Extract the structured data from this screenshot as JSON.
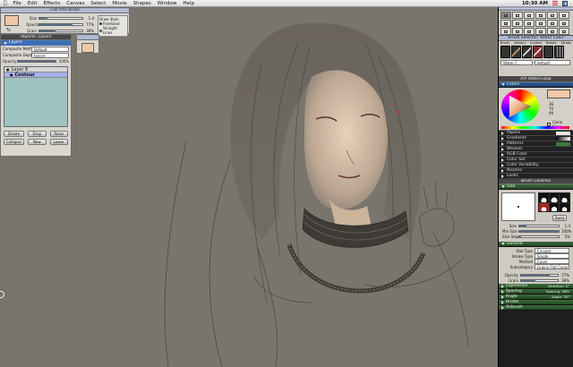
{
  "menubar": {
    "items": [
      "File",
      "Edit",
      "Effects",
      "Canvas",
      "Select",
      "Movie",
      "Shapes",
      "Window",
      "Help"
    ],
    "time": "10:30 AM"
  },
  "brush_props": {
    "title": "Cell Info Brush",
    "size_label": "Size",
    "opacity_label": "Opacity",
    "grain_label": "Grain",
    "size_value": "1.4",
    "opacity_value": "77%",
    "grain_value": "38%",
    "size_pct": 0.18,
    "opacity_pct": 0.77,
    "grain_pct": 0.38,
    "draw_style_label": "Draw Style",
    "freehand_label": "Freehand",
    "straight_label": "Straight Lines",
    "swatch_color": "#f0c8a8"
  },
  "layers": {
    "title": "Layers",
    "second_title": "Objects: Layers",
    "composite_method_label": "Composite Method",
    "composite_method_value": "Default",
    "composite_depth_label": "Composite Depth",
    "composite_depth_value": "Ignore",
    "opacity_label": "Opacity",
    "opacity_value": "100%",
    "items": [
      {
        "name": "Layer 8"
      },
      {
        "name": "Contour"
      }
    ],
    "buttons": [
      "Delete",
      "Drop",
      "Raise",
      "Collapse",
      "New",
      "Lower"
    ]
  },
  "tools": {
    "title": "Tools"
  },
  "brush_selector": {
    "title": "Brush Selector: Water Color",
    "tabs": [
      "Brush",
      "Variant",
      "Control",
      "Nozzle",
      "Stroke"
    ],
    "category": "Water C...",
    "variant": "default"
  },
  "art_pattern": {
    "title": "Art Pattern.bop"
  },
  "colors": {
    "title": "Colors",
    "clone_color_label": "Clone Color",
    "values": [
      "36",
      "70",
      "99"
    ],
    "accent": "#e8a070"
  },
  "panels": [
    "Papers",
    "Gradients",
    "Patterns",
    "Weaves",
    "RGB Color",
    "Color Set",
    "Color Variability",
    "Nozzles",
    "Looks"
  ],
  "brush_controls": {
    "title": "Brush Controls",
    "size_section": "Size",
    "size_label": "Size",
    "min_size_label": "Min Size",
    "size_step_label": "Size Step",
    "size_value": "1.4",
    "min_size_value": "100%",
    "size_step_value": "5%",
    "size_pct": 0.18,
    "min_size_pct": 1.0,
    "size_step_pct": 0.05,
    "build_label": "Build",
    "general_section": "General",
    "dab_type_label": "Dab Type",
    "dab_type_value": "Circular",
    "stroke_type_label": "Stroke Type",
    "stroke_type_value": "Single",
    "method_label": "Method",
    "method_value": "Cover",
    "subcategory_label": "Subcategory",
    "subcategory_value": "Grainy Flat Cover",
    "opacity_label": "Opacity",
    "opacity_value": "77%",
    "opacity_pct": 0.77,
    "grain_label": "Grain",
    "grain_value": "38%",
    "grain_pct": 0.38,
    "rows": [
      {
        "label": "Expression",
        "value": "Direction: 0°"
      },
      {
        "label": "Spacing",
        "value": "Spacing: 38%"
      },
      {
        "label": "Angle",
        "value": "Angle: 35°"
      },
      {
        "label": "Bristle",
        "value": ""
      },
      {
        "label": "Airbrush",
        "value": ""
      }
    ]
  }
}
